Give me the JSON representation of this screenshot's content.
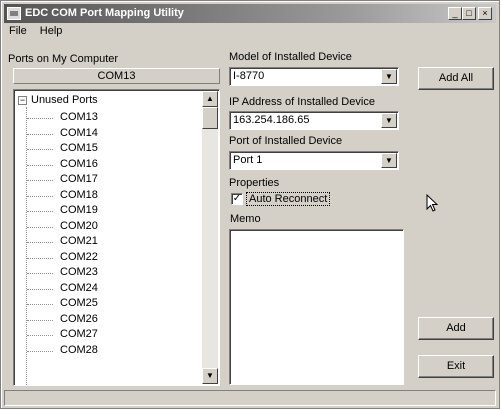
{
  "window": {
    "title": "EDC COM Port Mapping Utility",
    "controls": {
      "minimize": "_",
      "maximize": "□",
      "close": "×"
    }
  },
  "menu": {
    "file": "File",
    "help": "Help"
  },
  "ports_panel": {
    "label": "Ports on My Computer",
    "selected_port": "COM13",
    "tree_root": "Unused Ports",
    "expander": "−",
    "items": [
      "COM13",
      "COM14",
      "COM15",
      "COM16",
      "COM17",
      "COM18",
      "COM19",
      "COM20",
      "COM21",
      "COM22",
      "COM23",
      "COM24",
      "COM25",
      "COM26",
      "COM27",
      "COM28"
    ]
  },
  "device": {
    "model_label": "Model of Installed Device",
    "model_value": "I-8770",
    "ip_label": "IP Address of Installed Device",
    "ip_value": "163.254.186.65",
    "port_label": "Port of Installed Device",
    "port_value": "Port 1"
  },
  "properties": {
    "label": "Properties",
    "auto_reconnect_label": "Auto Reconnect",
    "auto_reconnect_checked": true,
    "check_mark": "✓"
  },
  "memo": {
    "label": "Memo",
    "value": ""
  },
  "buttons": {
    "add_all": "Add All",
    "add": "Add",
    "exit": "Exit"
  },
  "icons": {
    "scroll_up": "▲",
    "scroll_down": "▼",
    "dropdown": "▼"
  }
}
